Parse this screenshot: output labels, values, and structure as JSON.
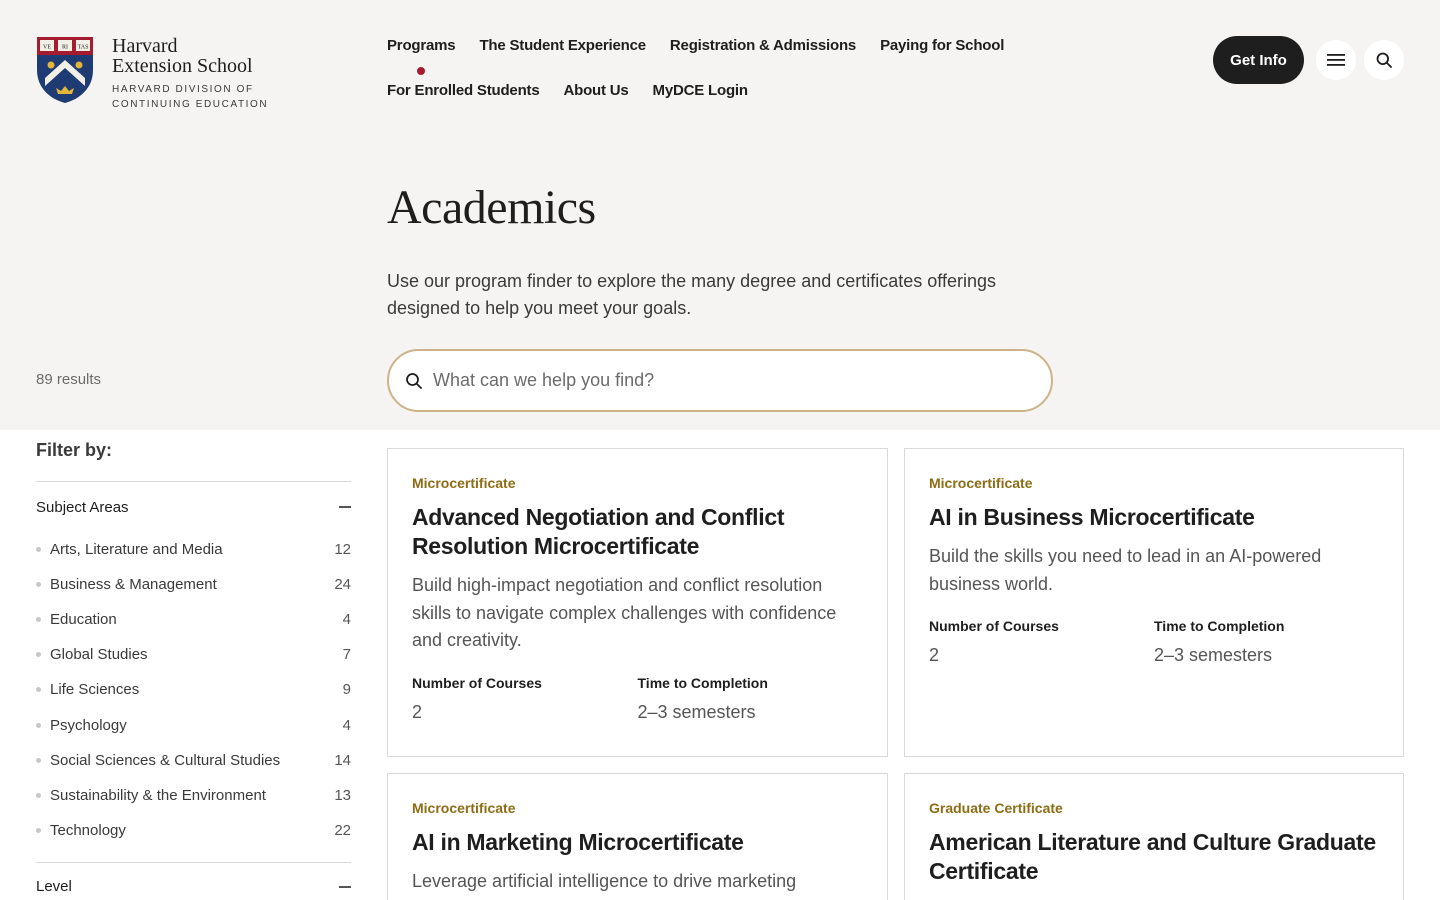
{
  "brand": {
    "name_line1": "Harvard",
    "name_line2": "Extension School",
    "sub_line1": "HARVARD DIVISION OF",
    "sub_line2": "CONTINUING EDUCATION",
    "shield_motto": [
      "VE",
      "RI",
      "TAS"
    ],
    "colors": {
      "crimson": "#a51c30",
      "navy": "#1f3b73",
      "gold": "#cdb387"
    }
  },
  "nav": {
    "row1": [
      "Programs",
      "The Student Experience",
      "Registration & Admissions",
      "Paying for School"
    ],
    "row2": [
      "For Enrolled Students",
      "About Us",
      "MyDCE Login"
    ],
    "active": "Programs",
    "get_info": "Get Info",
    "menu_icon": "hamburger-icon",
    "search_icon": "search-icon"
  },
  "hero": {
    "title": "Academics",
    "intro": "Use our program finder to explore the many degree and certificates offerings designed to help you meet your goals.",
    "search_placeholder": "What can we help you find?",
    "results": "89 results"
  },
  "filters": {
    "title": "Filter by:",
    "subject_heading": "Subject Areas",
    "subjects": [
      {
        "label": "Arts, Literature and Media",
        "count": "12"
      },
      {
        "label": "Business & Management",
        "count": "24"
      },
      {
        "label": "Education",
        "count": "4"
      },
      {
        "label": "Global Studies",
        "count": "7"
      },
      {
        "label": "Life Sciences",
        "count": "9"
      },
      {
        "label": "Psychology",
        "count": "4"
      },
      {
        "label": "Social Sciences & Cultural Studies",
        "count": "14"
      },
      {
        "label": "Sustainability & the Environment",
        "count": "13"
      },
      {
        "label": "Technology",
        "count": "22"
      }
    ],
    "level_heading": "Level"
  },
  "cards": [
    {
      "type": "Microcertificate",
      "title": "Advanced Negotiation and Conflict Resolution Microcertificate",
      "desc": "Build high-impact negotiation and conflict resolution skills to navigate complex challenges with confidence and creativity.",
      "courses_label": "Number of Courses",
      "courses": "2",
      "time_label": "Time to Completion",
      "time": "2–3 semesters"
    },
    {
      "type": "Microcertificate",
      "title": "AI in Business Microcertificate",
      "desc": "Build the skills you need to lead in an AI-powered business world.",
      "courses_label": "Number of Courses",
      "courses": "2",
      "time_label": "Time to Completion",
      "time": "2–3 semesters"
    },
    {
      "type": "Microcertificate",
      "title": "AI in Marketing Microcertificate",
      "desc": "Leverage artificial intelligence to drive marketing"
    },
    {
      "type": "Graduate Certificate",
      "title": "American Literature and Culture Graduate Certificate"
    }
  ]
}
